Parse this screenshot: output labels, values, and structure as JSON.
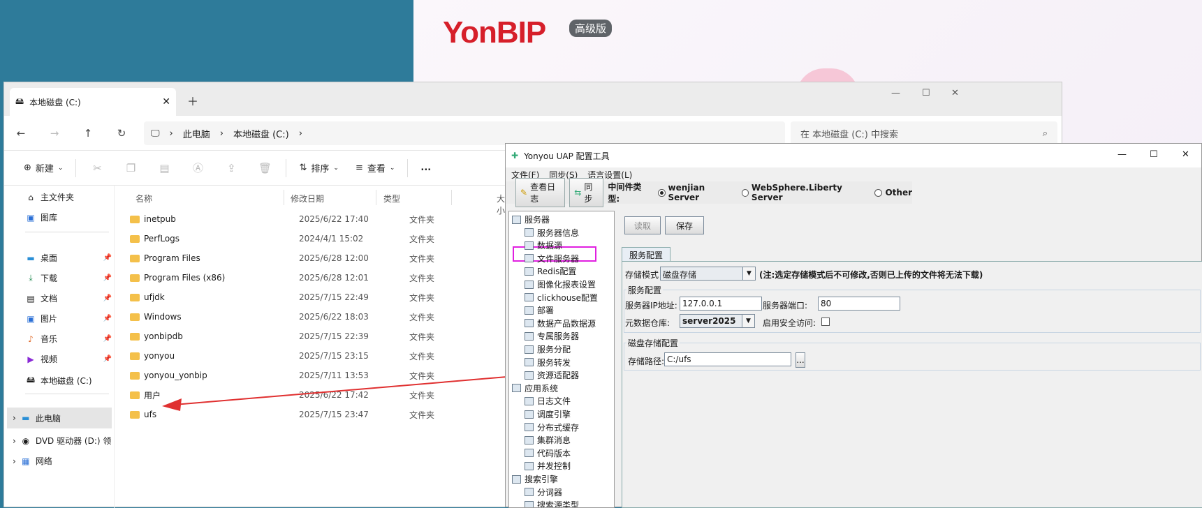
{
  "background": {
    "logo": "YonBIP",
    "badge": "高级版"
  },
  "explorer": {
    "tab_title": "本地磁盘 (C:)",
    "breadcrumb": [
      "此电脑",
      "本地磁盘 (C:)"
    ],
    "search_placeholder": "在 本地磁盘 (C:) 中搜索",
    "toolbar": {
      "new": "新建",
      "sort": "排序",
      "view": "查看",
      "more": "..."
    },
    "sidebar": {
      "items": [
        "主文件夹",
        "图库",
        "桌面",
        "下载",
        "文档",
        "图片",
        "音乐",
        "视频",
        "本地磁盘 (C:)",
        "此电脑",
        "DVD 驱动器 (D:) 领",
        "网络"
      ]
    },
    "columns": [
      "名称",
      "修改日期",
      "类型",
      "大小"
    ],
    "files": [
      {
        "name": "inetpub",
        "date": "2025/6/22 17:40",
        "type": "文件夹"
      },
      {
        "name": "PerfLogs",
        "date": "2024/4/1 15:02",
        "type": "文件夹"
      },
      {
        "name": "Program Files",
        "date": "2025/6/28 12:00",
        "type": "文件夹"
      },
      {
        "name": "Program Files (x86)",
        "date": "2025/6/28 12:01",
        "type": "文件夹"
      },
      {
        "name": "ufjdk",
        "date": "2025/7/15 22:49",
        "type": "文件夹"
      },
      {
        "name": "Windows",
        "date": "2025/6/22 18:03",
        "type": "文件夹"
      },
      {
        "name": "yonbipdb",
        "date": "2025/7/15 22:39",
        "type": "文件夹"
      },
      {
        "name": "yonyou",
        "date": "2025/7/15 23:15",
        "type": "文件夹"
      },
      {
        "name": "yonyou_yonbip",
        "date": "2025/7/11 13:53",
        "type": "文件夹"
      },
      {
        "name": "用户",
        "date": "2025/6/22 17:42",
        "type": "文件夹"
      },
      {
        "name": "ufs",
        "date": "2025/7/15 23:47",
        "type": "文件夹"
      }
    ]
  },
  "config": {
    "title": "Yonyou UAP 配置工具",
    "menu": [
      "文件(F)",
      "同步(S)",
      "语言设置(L)"
    ],
    "view_log": "查看日志",
    "sync": "同步",
    "middleware_label": "中间件类型:",
    "middleware": [
      "wenjian Server",
      "WebSphere.Liberty Server",
      "Other"
    ],
    "tree": [
      "服务器",
      "服务器信息",
      "数据源",
      "文件服务器",
      "Redis配置",
      "图像化报表设置",
      "clickhouse配置",
      "部署",
      "数据产品数据源",
      "专属服务器",
      "服务分配",
      "服务转发",
      "资源适配器",
      "应用系统",
      "日志文件",
      "调度引擎",
      "分布式缓存",
      "集群消息",
      "代码版本",
      "并发控制",
      "搜索引擎",
      "分词器",
      "搜索源类型"
    ],
    "read": "读取",
    "save": "保存",
    "panel_tab": "服务配置",
    "storage_mode_label": "存储模式",
    "storage_mode": "磁盘存储",
    "storage_note": "(注:选定存储模式后不可修改,否则已上传的文件将无法下载)",
    "service_cfg": "服务配置",
    "ip_label": "服务器IP地址:",
    "ip": "127.0.0.1",
    "port_label": "服务器端口:",
    "port": "80",
    "meta_label": "元数据仓库:",
    "meta": "server2025",
    "secure_label": "启用安全访问:",
    "disk_cfg": "磁盘存储配置",
    "path_label": "存储路径:",
    "path": "C:/ufs",
    "browse": "..."
  }
}
